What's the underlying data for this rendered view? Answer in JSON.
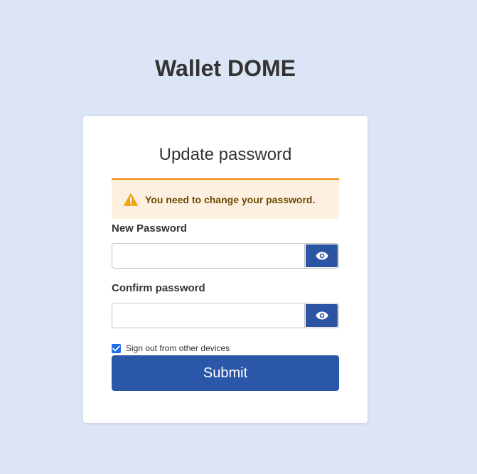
{
  "app": {
    "title": "Wallet DOME"
  },
  "form": {
    "title": "Update password",
    "alert": {
      "icon": "warning-icon",
      "text": "You need to change your password.",
      "color": "#ee8800"
    },
    "new_password": {
      "label": "New Password",
      "value": "",
      "toggle_icon": "eye-icon"
    },
    "confirm_password": {
      "label": "Confirm password",
      "value": "",
      "toggle_icon": "eye-icon"
    },
    "sign_out_other_devices": {
      "label": "Sign out from other devices",
      "checked": true
    },
    "submit_label": "Submit"
  },
  "colors": {
    "background": "#dbe5f6",
    "primary": "#2b57a8",
    "alert_background": "#fef0e1"
  }
}
